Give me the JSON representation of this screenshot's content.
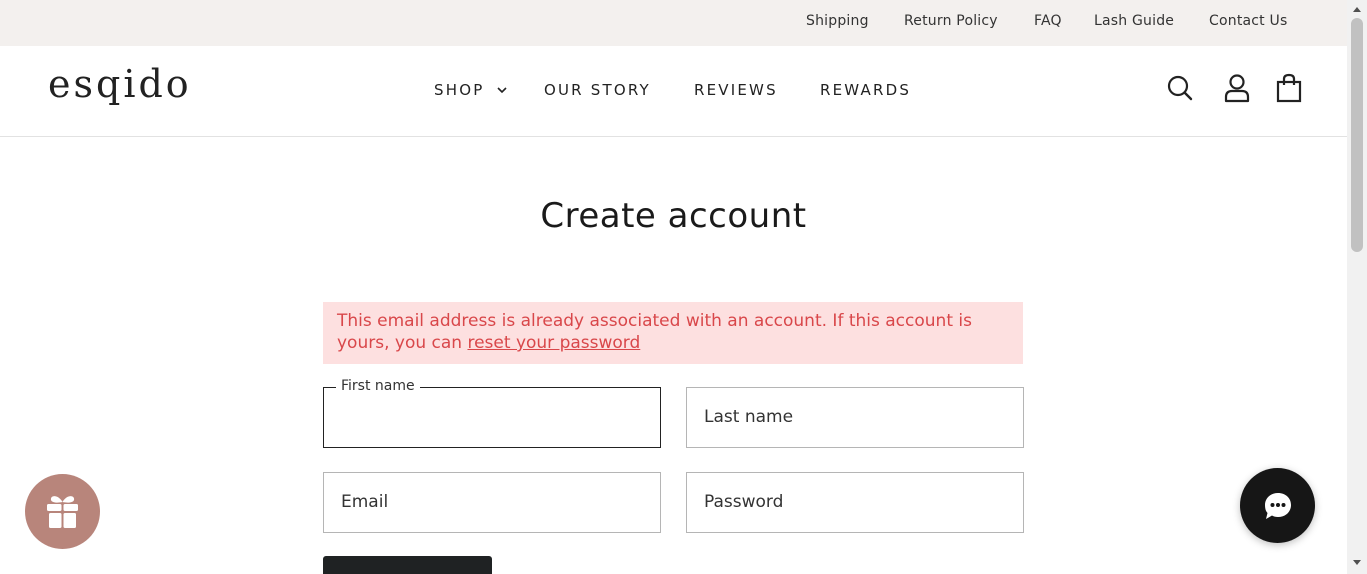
{
  "utility_nav": {
    "links": [
      "Shipping",
      "Return Policy",
      "FAQ",
      "Lash Guide",
      "Contact Us"
    ]
  },
  "header": {
    "logo": "esqido",
    "nav": [
      "SHOP",
      "OUR STORY",
      "REVIEWS",
      "REWARDS"
    ],
    "icons": [
      "search-icon",
      "account-icon",
      "cart-icon"
    ]
  },
  "page": {
    "title": "Create account"
  },
  "error": {
    "message": "This email address is already associated with an account. If this account is yours, you can ",
    "link": "reset your password"
  },
  "form": {
    "first_name_label": "First name",
    "last_name_placeholder": "Last name",
    "email_placeholder": "Email",
    "password_placeholder": "Password"
  },
  "colors": {
    "utility_bar": "#f3f0ee",
    "error_bg": "#fde0e0",
    "error_text": "#d9474a",
    "gift_button": "#b8857b",
    "chat_button": "#161616",
    "submit_button": "#1f2223"
  }
}
